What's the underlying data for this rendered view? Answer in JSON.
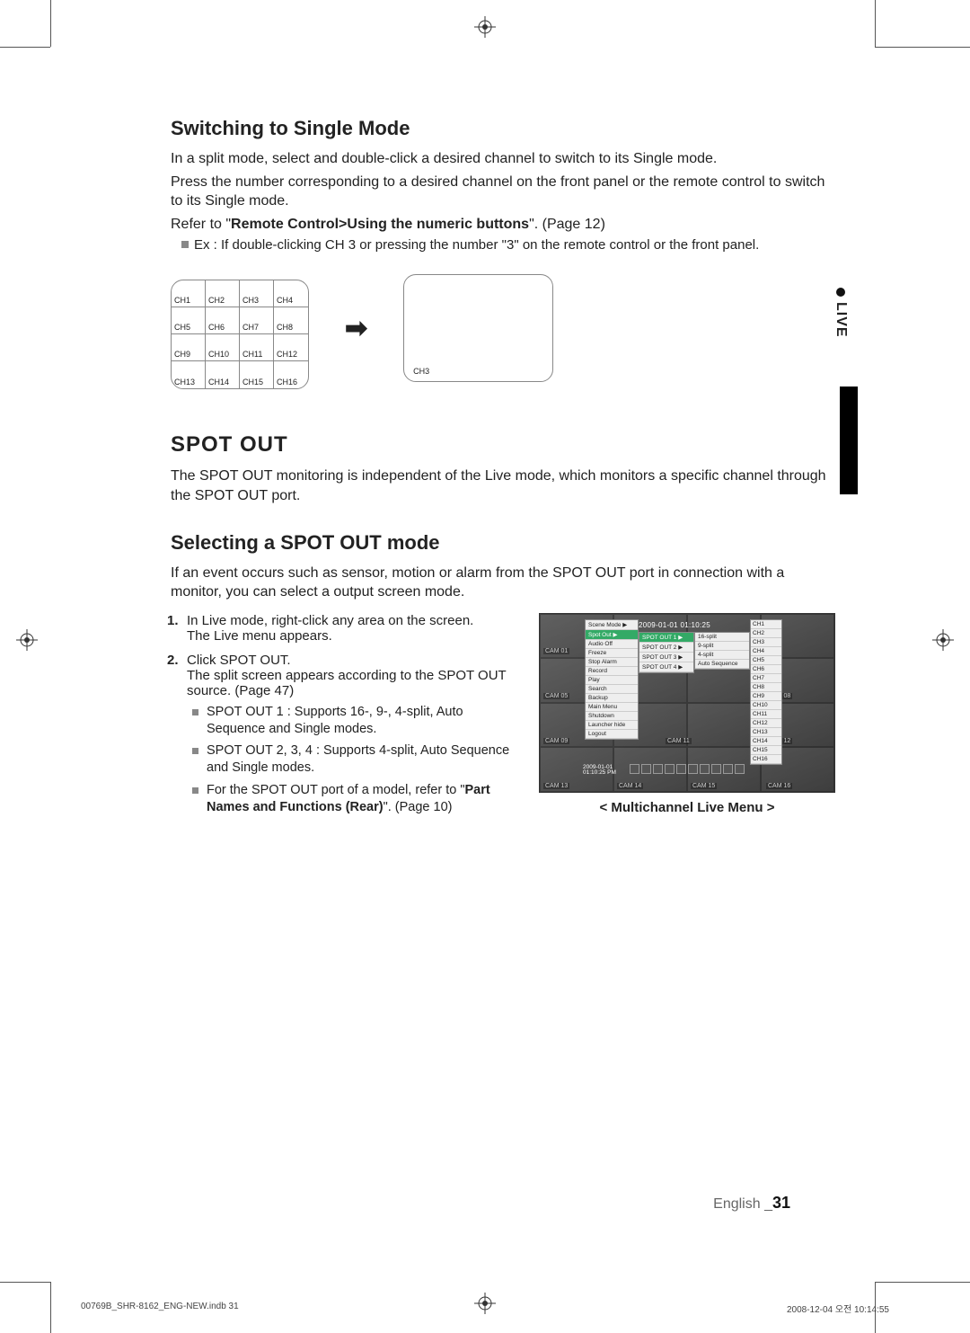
{
  "side_tab": "LIVE",
  "section1_title": "Switching to Single Mode",
  "section1_p1": "In a split mode, select and double-click a desired channel to switch to its Single mode.",
  "section1_p2": "Press the number corresponding to a desired channel on the front panel or the remote control to switch to its Single mode.",
  "section1_refer_prefix": "Refer to \"",
  "section1_refer_bold": "Remote Control>Using the numeric buttons",
  "section1_refer_suffix": "\". (Page 12)",
  "section1_example": "Ex : If double-clicking CH 3 or pressing the number \"3\" on the remote control or the front panel.",
  "grid_channels": [
    "CH1",
    "CH2",
    "CH3",
    "CH4",
    "CH5",
    "CH6",
    "CH7",
    "CH8",
    "CH9",
    "CH10",
    "CH11",
    "CH12",
    "CH13",
    "CH14",
    "CH15",
    "CH16"
  ],
  "single_label": "CH3",
  "spot_title": "SPOT OUT",
  "spot_p1": "The SPOT OUT monitoring is independent of the Live mode, which monitors a specific channel through the SPOT OUT port.",
  "section2_title": "Selecting a SPOT OUT mode",
  "section2_p1": "If an event occurs such as sensor, motion or alarm from the SPOT OUT port in connection with a monitor, you can select a output screen mode.",
  "step1_num": "1.",
  "step1a": "In Live mode, right-click any area on the screen.",
  "step1b": "The Live menu appears.",
  "step2_num": "2.",
  "step2a": "Click SPOT OUT.",
  "step2b": "The split screen appears according to the SPOT OUT source. (Page 47)",
  "sub1": "SPOT OUT 1 : Supports 16-, 9-, 4-split, Auto Sequence and Single modes.",
  "sub2": "SPOT OUT 2, 3, 4 : Supports 4-split, Auto Sequence and Single modes.",
  "sub3_prefix": "For the SPOT OUT port of a model, refer to \"",
  "sub3_bold1": "Part Names and Functions (Rear)",
  "sub3_suffix": "\". (Page 10)",
  "ss_date": "2009-01-01 01:10:25",
  "ss_datebox_line1": "2009-01-01",
  "ss_datebox_line2": "01:10:25 PM",
  "ss_menu": [
    "Scene Mode  ▶",
    "Spot Out  ▶",
    "Audio Off",
    "Freeze",
    "Stop Alarm",
    "Record",
    "Play",
    "Search",
    "Backup",
    "Main Menu",
    "Shutdown",
    "Launcher hide",
    "Logout"
  ],
  "ss_menu_hl_index": 1,
  "ss_sub1": [
    "SPOT OUT 1 ▶",
    "SPOT OUT 2 ▶",
    "SPOT OUT 3 ▶",
    "SPOT OUT 4 ▶"
  ],
  "ss_sub1_hl_index": 0,
  "ss_sub2": [
    "16-split",
    "9-split",
    "4-split",
    "Auto Sequence"
  ],
  "ss_sub3": [
    "CH1",
    "CH2",
    "CH3",
    "CH4",
    "CH5",
    "CH6",
    "CH7",
    "CH8",
    "CH9",
    "CH10",
    "CH11",
    "CH12",
    "CH13",
    "CH14",
    "CH15",
    "CH16"
  ],
  "ss_cams": [
    "CAM 01",
    "CAM 05",
    "",
    "CAM 08",
    "CAM 09",
    "CAM 11",
    "CAM 12",
    "CAM 13",
    "CAM 14",
    "CAM 15",
    "CAM 16"
  ],
  "ss_caption": "< Multichannel Live Menu >",
  "footer_lang": "English _",
  "footer_page": "31",
  "footer_file": "00769B_SHR-8162_ENG-NEW.indb   31",
  "footer_date": "2008-12-04   오전 10:14:55"
}
